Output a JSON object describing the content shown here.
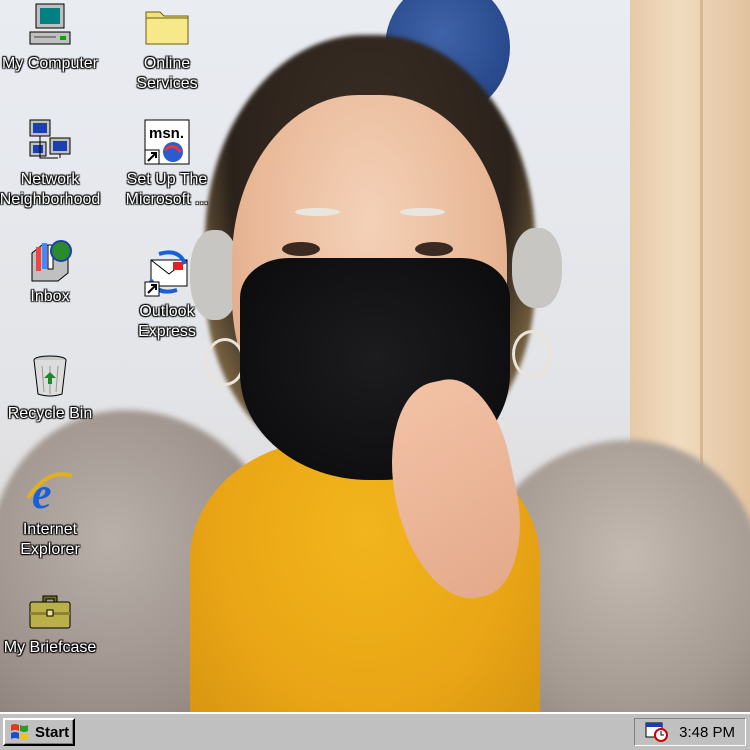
{
  "desktop": {
    "icons": [
      {
        "label": "My Computer"
      },
      {
        "label": "Online\nServices"
      },
      {
        "label": "Network\nNeighborhood"
      },
      {
        "label": "Set Up The\nMicrosoft ..."
      },
      {
        "label": "Inbox"
      },
      {
        "label": "Outlook\nExpress"
      },
      {
        "label": "Recycle Bin"
      },
      {
        "label": "Internet\nExplorer"
      },
      {
        "label": "My Briefcase"
      }
    ],
    "msn_logo_text": "msn."
  },
  "taskbar": {
    "start_label": "Start",
    "clock": "3:48 PM"
  },
  "colors": {
    "taskbar": "#c0c0c0",
    "ie_blue": "#1a5fd6"
  }
}
